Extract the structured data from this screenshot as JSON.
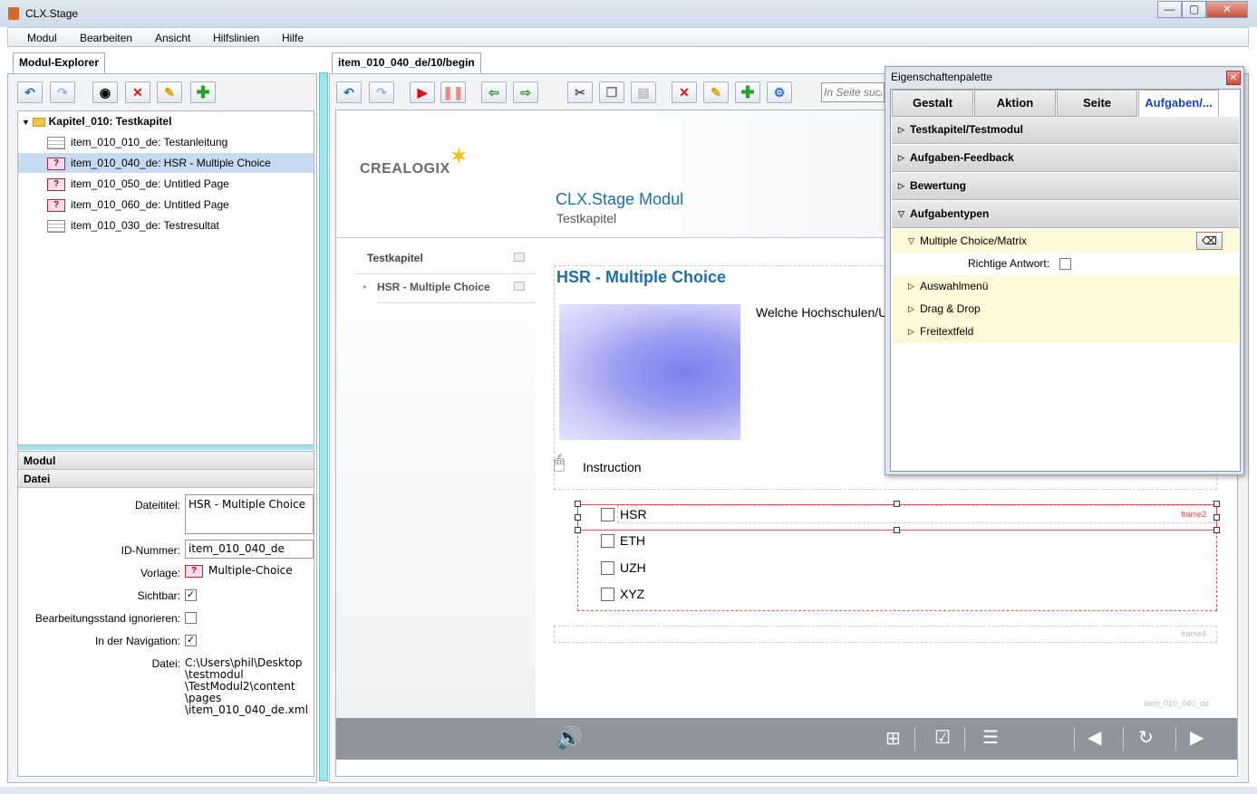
{
  "window": {
    "title": "CLX.Stage",
    "min": "—",
    "max": "▢",
    "close": "✕"
  },
  "menu": [
    "Modul",
    "Bearbeiten",
    "Ansicht",
    "Hilfslinien",
    "Hilfe"
  ],
  "left": {
    "tab": "Modul-Explorer",
    "tree": {
      "root": "Kapitel_010: Testkapitel",
      "items": [
        {
          "label": "item_010_010_de: Testanleitung",
          "icon": "page-icon"
        },
        {
          "label": "item_010_040_de: HSR - Multiple Choice",
          "icon": "question-icon",
          "selected": true
        },
        {
          "label": "item_010_050_de: Untitled Page",
          "icon": "question-icon"
        },
        {
          "label": "item_010_060_de: Untitled Page",
          "icon": "question-icon"
        },
        {
          "label": "item_010_030_de: Testresultat",
          "icon": "page-icon"
        }
      ]
    },
    "props": {
      "section1": "Modul",
      "section2": "Datei",
      "dateititel_label": "Dateititel:",
      "dateititel": "HSR - Multiple Choice",
      "id_label": "ID-Nummer:",
      "id": "item_010_040_de",
      "vorlage_label": "Vorlage:",
      "vorlage": "Multiple-Choice",
      "sichtbar_label": "Sichtbar:",
      "ignorieren_label": "Bearbeitungsstand ignorieren:",
      "navigation_label": "In der Navigation:",
      "datei_label": "Datei:",
      "datei_lines": [
        "C:\\Users\\phil\\Desktop",
        "\\testmodul",
        "\\TestModul2\\content",
        "\\pages",
        "\\item_010_040_de.xml"
      ],
      "sichtbar": true,
      "ignorieren": false,
      "navigation": true
    }
  },
  "editor": {
    "tab": "item_010_040_de/10/begin",
    "search_placeholder": "In Seite such",
    "logo": "CREALOGIX",
    "module_title": "CLX.Stage Modul",
    "chapter": "Testkapitel",
    "nav_chapter": "Testkapitel",
    "nav_page": "HSR - Multiple Choice",
    "page_title": "HSR - Multiple Choice",
    "question": "Welche Hochschulen/U",
    "instruction": "Instruction",
    "options": [
      "HSR",
      "ETH",
      "UZH",
      "XYZ"
    ],
    "frame2": "frame2",
    "frame4": "frame4",
    "page_id": "item_010_040_de"
  },
  "palette": {
    "title": "Eigenschaftenpalette",
    "tabs": [
      "Gestalt",
      "Aktion",
      "Seite",
      "Aufgaben/..."
    ],
    "sections": [
      "Testkapitel/Testmodul",
      "Aufgaben-Feedback",
      "Bewertung",
      "Aufgabentypen"
    ],
    "subtype": "Multiple Choice/Matrix",
    "richtige": "Richtige Antwort:",
    "subitems": [
      "Auswahlmenü",
      "Drag & Drop",
      "Freitextfeld"
    ]
  },
  "colors": {
    "accent": "#1d6fa5",
    "selected_row": "#c6daf0",
    "palette_active_tab": "#1a3fc9"
  }
}
